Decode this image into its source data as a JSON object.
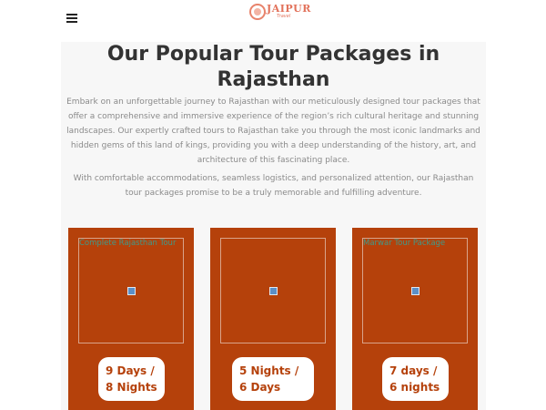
{
  "header": {
    "menu_icon": "hamburger-menu-icon",
    "logo_text": "JAIPUR",
    "logo_sub": "Travel"
  },
  "section": {
    "title": "Our Popular Tour Packages in Rajasthan",
    "paragraph_1": "Embark on an unforgettable journey to Rajasthan with our meticulously designed tour packages that offer a comprehensive and immersive experience of the region’s rich cultural heritage and stunning landscapes. Our expertly crafted tours to Rajasthan take you through the most iconic landmarks and hidden gems of this land of kings, providing you with a deep understanding of the history, art, and architecture of this fascinating place.",
    "paragraph_2": "With comfortable accommodations, seamless logistics, and personalized attention, our Rajasthan tour packages promise to be a truly memorable and fulfilling adventure."
  },
  "packages": [
    {
      "image_alt": "Complete Rajasthan Tour",
      "duration": "9 Days / 8 Nights"
    },
    {
      "image_alt": "",
      "duration": "5 Nights / 6 Days"
    },
    {
      "image_alt": "Marwar Tour Package",
      "duration": "7 days / 6 nights"
    }
  ],
  "colors": {
    "card_bg": "#b5410b",
    "logo": "#e2725b",
    "section_bg": "#f7f7f7"
  }
}
